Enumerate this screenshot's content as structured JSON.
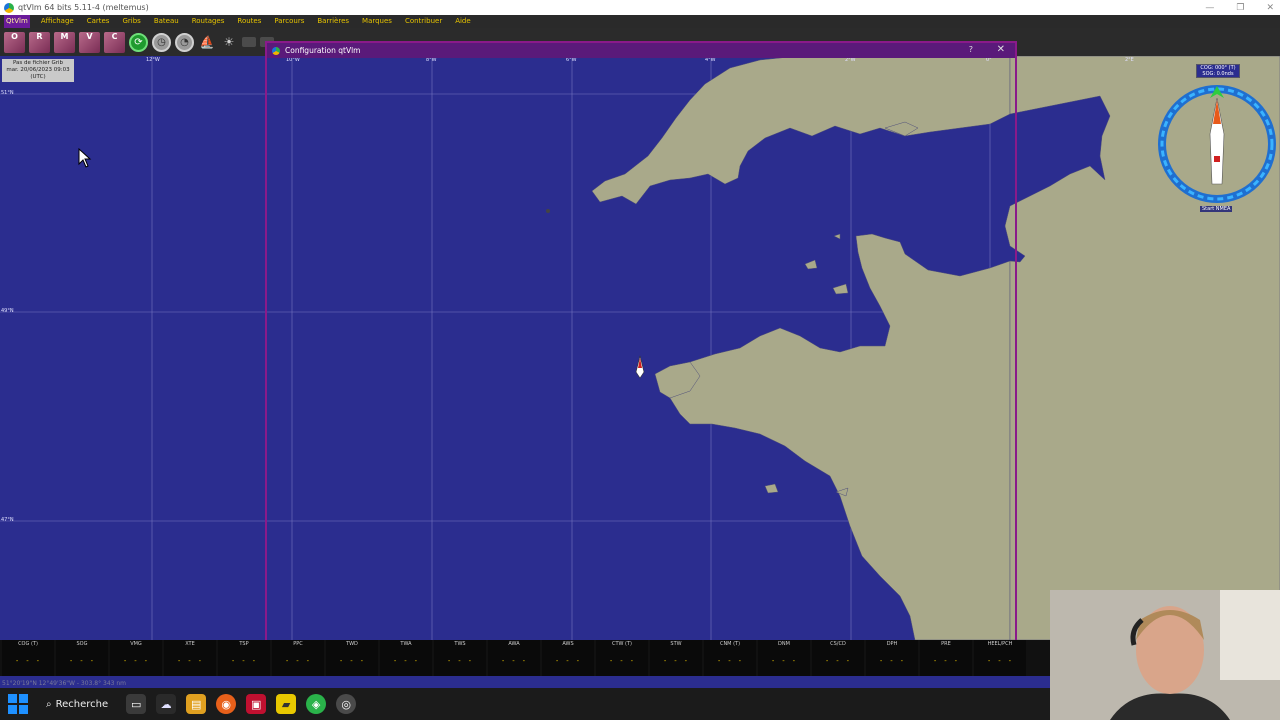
{
  "window": {
    "title": "qtVlm 64 bits 5.11-4 (meltemus)",
    "minimize": "—",
    "maximize": "❐",
    "close": "✕"
  },
  "menu": [
    "QtVlm",
    "Affichage",
    "Cartes",
    "Gribs",
    "Bateau",
    "Routages",
    "Routes",
    "Parcours",
    "Barrières",
    "Marques",
    "Contribuer",
    "Aide"
  ],
  "toolbar": {
    "buttons": [
      {
        "label": "O",
        "icon": "open-grib-icon"
      },
      {
        "label": "R",
        "icon": "grib-r-icon"
      },
      {
        "label": "M",
        "icon": "grib-m-icon"
      },
      {
        "label": "V",
        "icon": "grib-v-icon"
      },
      {
        "label": "C",
        "icon": "grib-c-icon"
      }
    ]
  },
  "map": {
    "grib_info": {
      "line1": "Pas de fichier Grib",
      "line2": "mar. 20/06/2023 09:03",
      "line3": "(UTC)"
    },
    "lat_labels": [
      "51°N",
      "49°N",
      "47°N"
    ],
    "lon_labels": [
      "12°W",
      "10°W",
      "8°W",
      "6°W",
      "4°W",
      "2°W",
      "0°",
      "2°E"
    ]
  },
  "dialog": {
    "title": "Configuration qtVlm",
    "help": "?",
    "close": "✕"
  },
  "compass": {
    "cog": "COG: 000° (T)",
    "sog": "SOG: 0.0nds",
    "nmea_label": "Start NMEA"
  },
  "instruments": [
    {
      "label": "COG (T)",
      "value": "- - -"
    },
    {
      "label": "SOG",
      "value": "- - -"
    },
    {
      "label": "VMG",
      "value": "- - -"
    },
    {
      "label": "XTE",
      "value": "- - -"
    },
    {
      "label": "TSP",
      "value": "- - -"
    },
    {
      "label": "PPC",
      "value": "- - -"
    },
    {
      "label": "TWD",
      "value": "- - -"
    },
    {
      "label": "TWA",
      "value": "- - -"
    },
    {
      "label": "TWS",
      "value": "- - -"
    },
    {
      "label": "AWA",
      "value": "- - -"
    },
    {
      "label": "AWS",
      "value": "- - -"
    },
    {
      "label": "CTW (T)",
      "value": "- - -"
    },
    {
      "label": "STW",
      "value": "- - -"
    },
    {
      "label": "CNM (T)",
      "value": "- - -"
    },
    {
      "label": "DNM",
      "value": "- - -"
    },
    {
      "label": "CS/CD",
      "value": "- - -"
    },
    {
      "label": "DPH",
      "value": "- - -"
    },
    {
      "label": "PRE",
      "value": "- - -"
    },
    {
      "label": "HEEL/PCH",
      "value": "- - -"
    }
  ],
  "status_coords": "51°20'19\"N 12°49'36\"W - 303.8° 343 nm",
  "taskbar": {
    "search_label": "Recherche"
  },
  "colors": {
    "sea": "#2b2d8f",
    "land": "#a9a98a",
    "menu_text": "#e6c300",
    "dialog_border": "#8a1a8a"
  }
}
